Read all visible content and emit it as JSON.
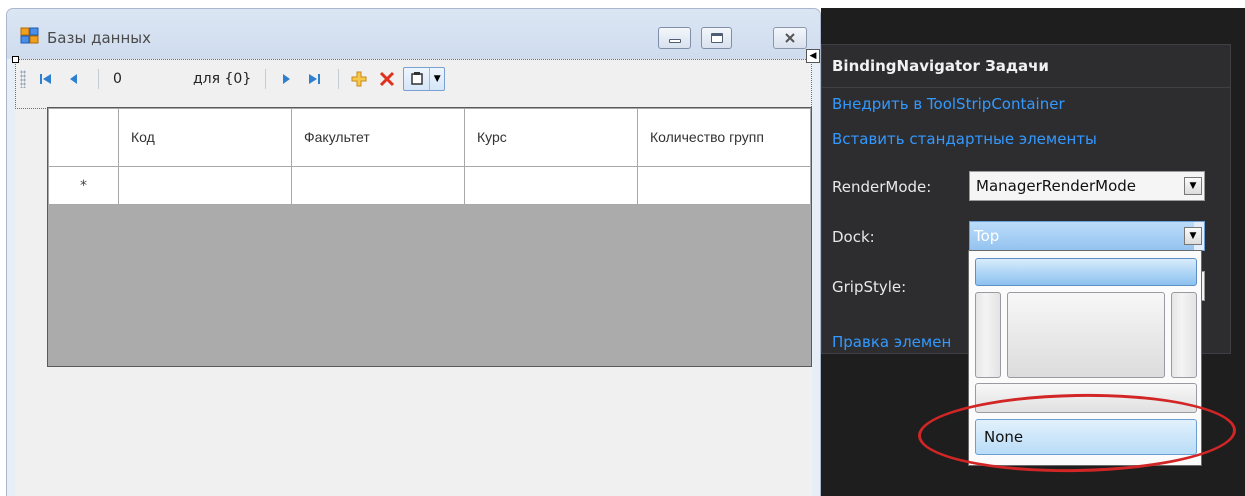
{
  "form": {
    "title": "Базы данных",
    "icon": "form-icon"
  },
  "navigator": {
    "position_value": "0",
    "count_label": "для {0}",
    "icons": [
      "move-first-icon",
      "move-previous-icon",
      "move-next-icon",
      "move-last-icon",
      "add-new-icon",
      "delete-icon",
      "add-toolstrip-item-icon"
    ]
  },
  "grid": {
    "columns": [
      "Код",
      "Факультет",
      "Курс",
      "Количество групп"
    ],
    "new_row_marker": "*"
  },
  "smart_tag": {
    "title": "BindingNavigator Задачи",
    "link_embed": "Внедрить в ToolStripContainer",
    "link_insert": "Вставить стандартные элементы",
    "link_edit": "Правка элемен",
    "render_mode_label": "RenderMode:",
    "render_mode_value": "ManagerRenderMode",
    "dock_label": "Dock:",
    "dock_value": "Top",
    "grip_style_label": "GripStyle:"
  },
  "dock_editor": {
    "none_label": "None"
  },
  "colors": {
    "panel_bg": "#2d2d30",
    "link": "#3399ff",
    "annotation": "#d22626",
    "selection": "#94c3f0"
  }
}
